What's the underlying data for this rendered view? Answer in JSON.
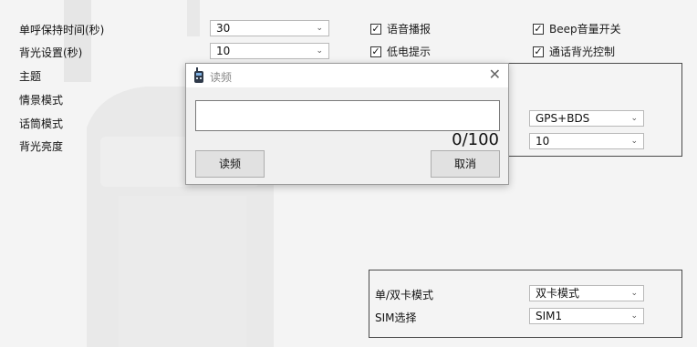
{
  "settings": {
    "left_labels": [
      "单呼保持时间(秒)",
      "背光设置(秒)",
      "主题",
      "情景模式",
      "话筒模式",
      "背光亮度"
    ],
    "hold_time": {
      "value": "30"
    },
    "backlight_time": {
      "value": "10"
    },
    "checkboxes": [
      {
        "label": "语音播报",
        "checked": true
      },
      {
        "label": "低电提示",
        "checked": true
      },
      {
        "label": "Beep音量开关",
        "checked": true
      },
      {
        "label": "通话背光控制",
        "checked": true
      }
    ],
    "positioning": {
      "value": "GPS+BDS"
    },
    "brightness_right": {
      "value": "10"
    }
  },
  "sim_group": {
    "mode_label": "单/双卡模式",
    "mode_value": "双卡模式",
    "sim_label": "SIM选择",
    "sim_value": "SIM1"
  },
  "dialog": {
    "title": "读频",
    "input_value": "",
    "counter": "0/100",
    "read_button": "读频",
    "cancel_button": "取消"
  },
  "icons": {
    "combo_arrow": "chevron-down-icon",
    "close": "close-icon",
    "app": "radio-icon",
    "check": "check-icon"
  },
  "colors": {
    "background": "#f4f4f4",
    "dialog_title_bg": "#ffffff",
    "button_bg": "#e1e1e1"
  }
}
